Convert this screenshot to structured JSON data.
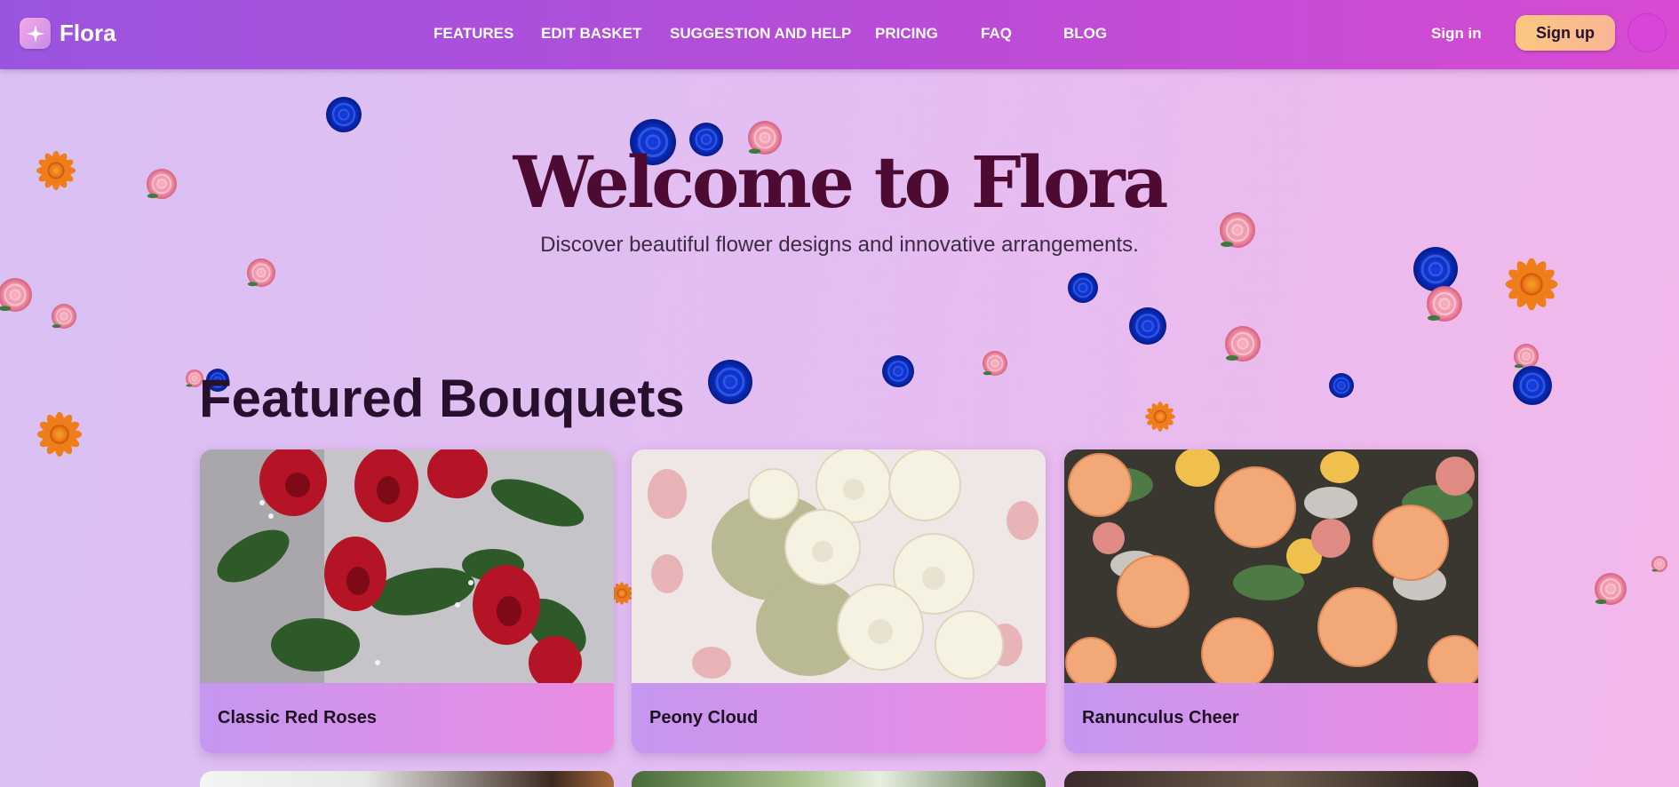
{
  "header": {
    "brand": "Flora",
    "nav": [
      "FEATURES",
      "EDIT BASKET",
      "SUGGESTION AND HELP",
      "PRICING",
      "FAQ",
      "BLOG"
    ],
    "sign_in": "Sign in",
    "sign_up": "Sign up"
  },
  "hero": {
    "title": "Welcome to Flora",
    "subtitle": "Discover beautiful flower designs and innovative arrangements."
  },
  "featured": {
    "title": "Featured Bouquets",
    "cards": [
      {
        "name": "Classic Red Roses"
      },
      {
        "name": "Peony Cloud"
      },
      {
        "name": "Ranunculus Cheer"
      }
    ]
  },
  "colors": {
    "header_start": "#9a55e0",
    "header_end": "#d74bd2",
    "accent_button": "#fbc77f",
    "title": "#4d0a33"
  }
}
